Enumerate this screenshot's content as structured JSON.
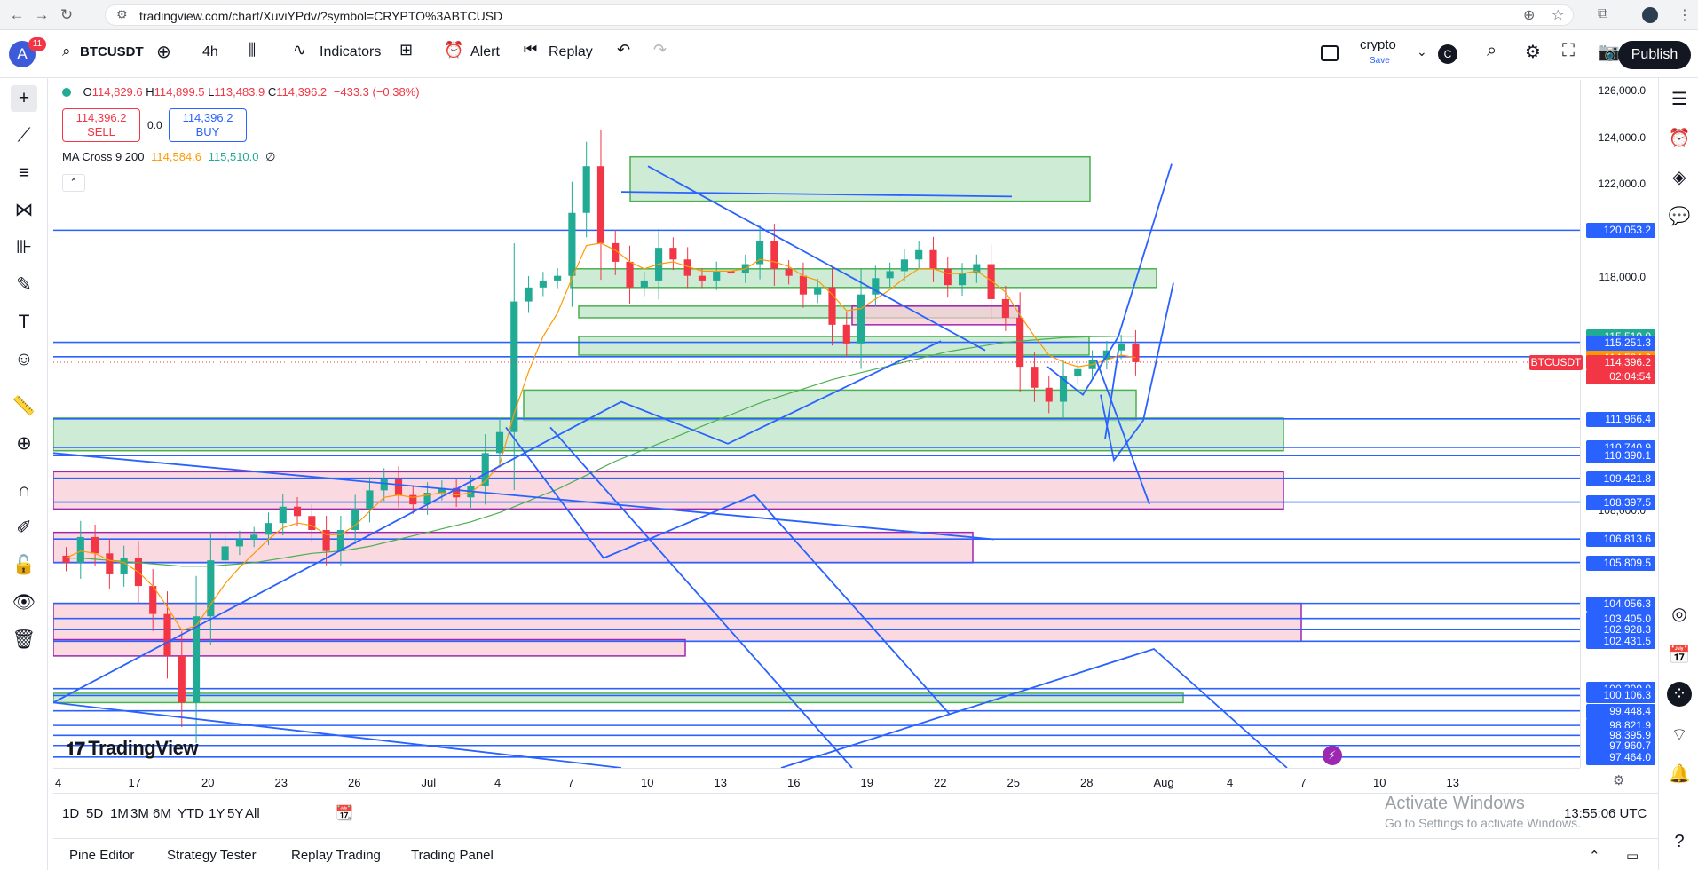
{
  "browser": {
    "url": "tradingview.com/chart/XuviYPdv/?symbol=CRYPTO%3ABTCUSD"
  },
  "toolbar": {
    "avatar_letter": "A",
    "notification_count": "11",
    "symbol": "BTCUSDT",
    "interval": "4h",
    "indicators_label": "Indicators",
    "alert_label": "Alert",
    "replay_label": "Replay",
    "layout_name": "crypto",
    "layout_save": "Save",
    "layout_icon_letter": "C",
    "publish_label": "Publish"
  },
  "legend": {
    "open_label": "O",
    "open": "114,829.6",
    "high_label": "H",
    "high": "114,899.5",
    "low_label": "L",
    "low": "113,483.9",
    "close_label": "C",
    "close": "114,396.2",
    "change": "−433.3 (−0.38%)",
    "sell_price": "114,396.2",
    "sell_label": "SELL",
    "spread": "0.0",
    "buy_price": "114,396.2",
    "buy_label": "BUY",
    "ma_label": "MA Cross 9 200",
    "ma_fast": "114,584.6",
    "ma_slow": "115,510.0",
    "ma_extra": "∅"
  },
  "chart_data": {
    "type": "candlestick",
    "title": "BTCUSDT",
    "interval": "4h",
    "ylim": [
      97000,
      126500
    ],
    "y_ticks": [
      "126,000.0",
      "124,000.0",
      "122,000.0",
      "118,000.0",
      "108,000.0"
    ],
    "x_ticks": [
      "4",
      "17",
      "20",
      "23",
      "26",
      "Jul",
      "4",
      "7",
      "10",
      "13",
      "16",
      "19",
      "22",
      "25",
      "28",
      "Aug",
      "4",
      "7",
      "10",
      "13"
    ],
    "price_labels": [
      {
        "value": "120,053.2",
        "color": "#2962ff"
      },
      {
        "value": "115,510.0",
        "color": "#22ab94"
      },
      {
        "value": "115,251.3",
        "color": "#2962ff"
      },
      {
        "value": "114,631.2",
        "color": "#2962ff"
      },
      {
        "value": "114,584.6",
        "color": "#ff9800"
      },
      {
        "value": "114,396.2",
        "color": "#f23645"
      },
      {
        "value": "111,966.4",
        "color": "#2962ff"
      },
      {
        "value": "110,740.9",
        "color": "#2962ff"
      },
      {
        "value": "110,390.1",
        "color": "#2962ff"
      },
      {
        "value": "109,421.8",
        "color": "#2962ff"
      },
      {
        "value": "108,397.5",
        "color": "#2962ff"
      },
      {
        "value": "106,813.6",
        "color": "#2962ff"
      },
      {
        "value": "105,809.5",
        "color": "#2962ff"
      },
      {
        "value": "104,056.3",
        "color": "#2962ff"
      },
      {
        "value": "103,405.0",
        "color": "#2962ff"
      },
      {
        "value": "102,928.3",
        "color": "#2962ff"
      },
      {
        "value": "102,431.5",
        "color": "#2962ff"
      },
      {
        "value": "100,399.0",
        "color": "#2962ff"
      },
      {
        "value": "100,106.3",
        "color": "#2962ff"
      },
      {
        "value": "99,448.4",
        "color": "#2962ff"
      },
      {
        "value": "98,821.9",
        "color": "#2962ff"
      },
      {
        "value": "98,395.9",
        "color": "#2962ff"
      },
      {
        "value": "97,960.7",
        "color": "#2962ff"
      },
      {
        "value": "97,464.0",
        "color": "#2962ff"
      }
    ],
    "countdown": "02:04:54",
    "symbol_tag": "BTCUSDT",
    "last_price": 114396.2,
    "price_path": [
      105800,
      106900,
      106200,
      105300,
      106000,
      104800,
      103600,
      101800,
      99800,
      103500,
      105900,
      106500,
      106800,
      107000,
      107500,
      108200,
      107800,
      107200,
      106300,
      107200,
      108100,
      108900,
      109400,
      108700,
      108300,
      108800,
      109000,
      108600,
      109100,
      110500,
      111400,
      117000,
      117600,
      117900,
      118100,
      120800,
      122800,
      119500,
      118700,
      117600,
      117900,
      119300,
      118800,
      118100,
      117900,
      118300,
      118200,
      118600,
      119600,
      118400,
      118100,
      117300,
      117600,
      116000,
      115200,
      117300,
      118000,
      118300,
      118800,
      119200,
      118400,
      117700,
      118200,
      118600,
      117100,
      116300,
      114200,
      113300,
      112700,
      113800,
      114100,
      114500,
      114900,
      115200,
      114400
    ],
    "ma_fast": [
      106000,
      106300,
      106200,
      105900,
      105800,
      105400,
      104800,
      103900,
      102900,
      103100,
      104000,
      104900,
      105600,
      106200,
      106800,
      107300,
      107500,
      107400,
      107000,
      107000,
      107400,
      108000,
      108600,
      108700,
      108600,
      108700,
      108800,
      108700,
      108800,
      109300,
      110000,
      112200,
      114000,
      115500,
      116500,
      118000,
      119400,
      119500,
      119200,
      118700,
      118400,
      118600,
      118700,
      118500,
      118300,
      118300,
      118300,
      118400,
      118800,
      118700,
      118500,
      118100,
      117900,
      117300,
      116600,
      116700,
      117100,
      117500,
      118000,
      118400,
      118400,
      118200,
      118200,
      118300,
      117900,
      117400,
      116400,
      115500,
      114700,
      114400,
      114200,
      114300,
      114500,
      114700,
      114600
    ],
    "ma_slow": [
      106000,
      106000,
      105950,
      105900,
      105850,
      105800,
      105750,
      105700,
      105650,
      105650,
      105650,
      105700,
      105750,
      105800,
      105900,
      106000,
      106100,
      106200,
      106250,
      106300,
      106400,
      106500,
      106650,
      106800,
      106950,
      107100,
      107250,
      107400,
      107550,
      107750,
      107950,
      108200,
      108450,
      108700,
      108950,
      109250,
      109550,
      109850,
      110150,
      110400,
      110650,
      110900,
      111150,
      111400,
      111650,
      111900,
      112150,
      112400,
      112650,
      112850,
      113050,
      113250,
      113450,
      113650,
      113800,
      113950,
      114100,
      114250,
      114400,
      114550,
      114700,
      114850,
      114950,
      115050,
      115150,
      115250,
      115300,
      115350,
      115400,
      115450,
      115470,
      115490,
      115500,
      115510,
      115510
    ]
  },
  "chart_overlay": {
    "logo_text": "TradingView",
    "time_display": "13:55:06 UTC",
    "watermark_title": "Activate Windows",
    "watermark_sub": "Go to Settings to activate Windows."
  },
  "range_buttons": [
    "1D",
    "5D",
    "1M",
    "3M",
    "6M",
    "YTD",
    "1Y",
    "5Y",
    "All"
  ],
  "bottom_tabs": [
    "Pine Editor",
    "Strategy Tester",
    "Replay Trading",
    "Trading Panel"
  ],
  "colors": {
    "up": "#22ab94",
    "down": "#f23645",
    "drawing_blue": "#2962ff",
    "green_zone": "#b9e3c3",
    "pink_zone": "#f9c9d4"
  }
}
